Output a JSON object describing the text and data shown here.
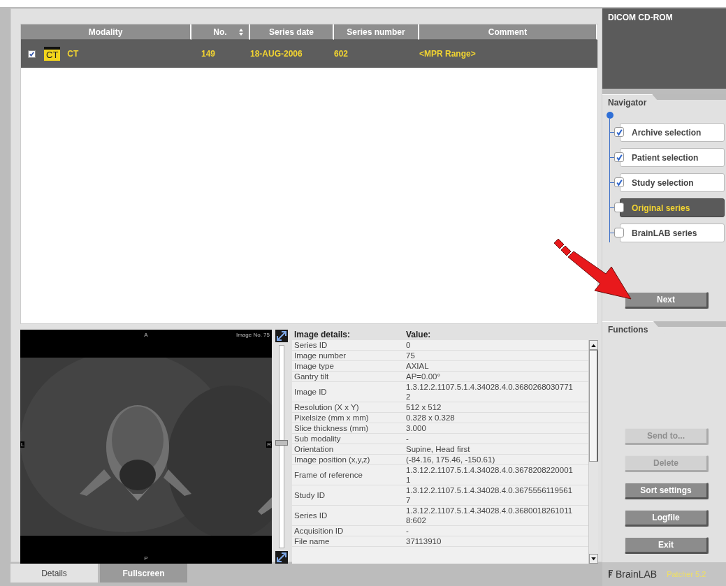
{
  "series_table": {
    "columns": [
      {
        "label": "Modality",
        "sorted": false
      },
      {
        "label": "No.",
        "sorted": true
      },
      {
        "label": "Series date",
        "sorted": false
      },
      {
        "label": "Series number",
        "sorted": false
      },
      {
        "label": "Comment",
        "sorted": false
      }
    ],
    "rows": [
      {
        "checked": true,
        "selected": true,
        "badge": "CT",
        "modality": "CT",
        "no": "149",
        "series_date": "18-AUG-2006",
        "series_number": "602",
        "comment": "<MPR Range>"
      }
    ]
  },
  "viewer": {
    "top_label": "A",
    "bottom_label": "P",
    "left_label": "L",
    "right_label": "R",
    "image_label": "Image No. 75",
    "slider": {
      "level": 0.52
    }
  },
  "details": {
    "header": [
      "Image details:",
      "Value:"
    ],
    "rows": [
      {
        "label": "Series ID",
        "value": "0"
      },
      {
        "label": "Image number",
        "value": "75"
      },
      {
        "label": "Image type",
        "value": "AXIAL"
      },
      {
        "label": "Gantry tilt",
        "value": "AP=0.00°"
      },
      {
        "label": "Image ID",
        "value": "1.3.12.2.1107.5.1.4.34028.4.0.3680268030771\n2"
      },
      {
        "label": "Resolution (X x Y)",
        "value": "512 x 512"
      },
      {
        "label": "Pixelsize (mm x mm)",
        "value": "0.328 x 0.328"
      },
      {
        "label": "Slice thickness (mm)",
        "value": "3.000"
      },
      {
        "label": "Sub modality",
        "value": "-"
      },
      {
        "label": "Orientation",
        "value": "Supine, Head first"
      },
      {
        "label": "Image position (x,y,z)",
        "value": "(-84.16, 175.46, -150.61)"
      },
      {
        "label": "Frame of reference",
        "value": "1.3.12.2.1107.5.1.4.34028.4.0.3678208220001\n1"
      },
      {
        "label": "Study ID",
        "value": "1.3.12.2.1107.5.1.4.34028.4.0.3675556119561\n7"
      },
      {
        "label": "Series ID",
        "value": "1.3.12.2.1107.5.1.4.34028.4.0.3680018261011\n8:602"
      },
      {
        "label": "Acquisition ID",
        "value": "-"
      },
      {
        "label": "File name",
        "value": "37113910"
      }
    ]
  },
  "bottom_tabs": [
    {
      "label": "Details",
      "selected": true
    },
    {
      "label": "Fullscreen",
      "selected": false
    }
  ],
  "source": {
    "title": "DICOM CD-ROM"
  },
  "navigator": {
    "tab": "Navigator",
    "steps": [
      {
        "label": "Archive selection",
        "checked": true,
        "selected": false
      },
      {
        "label": "Patient selection",
        "checked": true,
        "selected": false
      },
      {
        "label": "Study selection",
        "checked": true,
        "selected": false
      },
      {
        "label": "Original series",
        "checked": false,
        "selected": true
      },
      {
        "label": "BrainLAB series",
        "checked": false,
        "selected": false
      }
    ],
    "next_button": "Next"
  },
  "functions": {
    "tab": "Functions",
    "buttons": [
      {
        "label": "Send to...",
        "disabled": true
      },
      {
        "label": "Delete",
        "disabled": true
      },
      {
        "label": "Sort settings",
        "disabled": false
      },
      {
        "label": "Logfile",
        "disabled": false
      },
      {
        "label": "Exit",
        "disabled": false
      }
    ]
  },
  "footer": {
    "logo": "BrainLAB",
    "version": "Patcher 5.2"
  },
  "annotations": [
    {
      "kind": "arrow"
    }
  ]
}
